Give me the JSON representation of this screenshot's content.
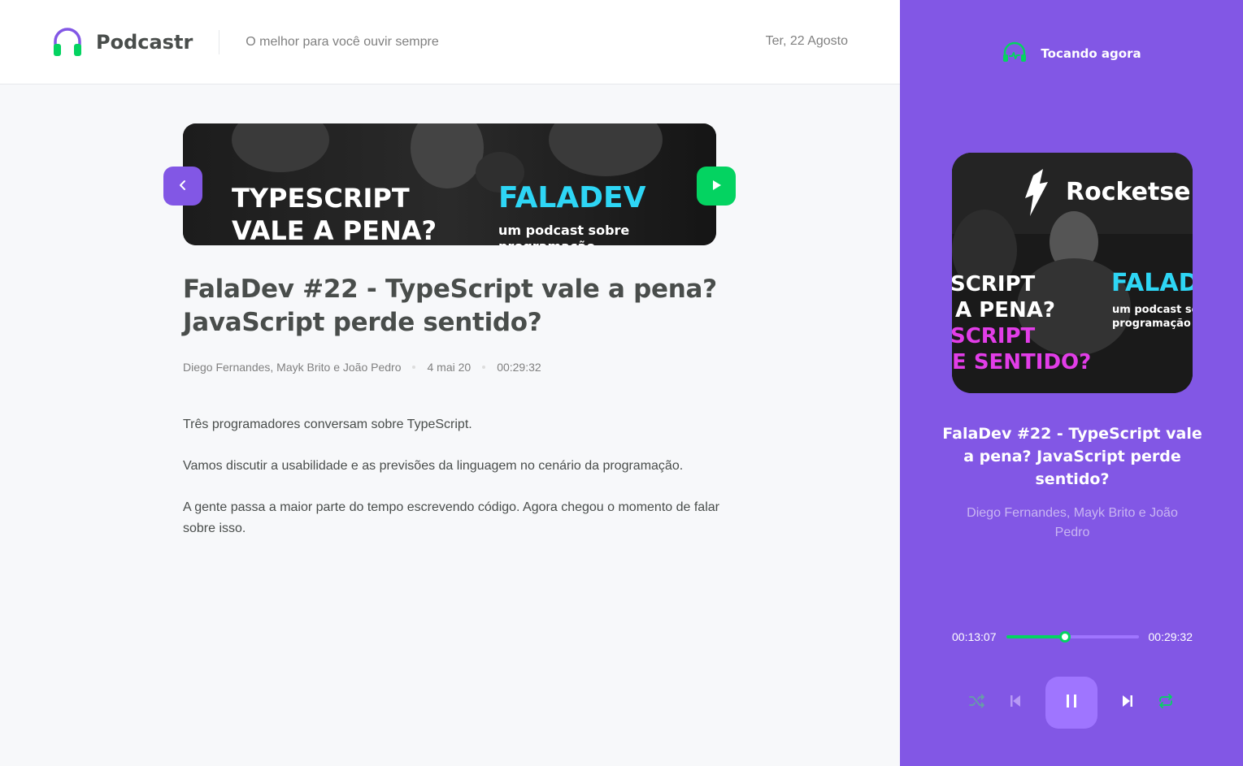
{
  "header": {
    "logo_text": "Podcastr",
    "tagline": "O melhor para você ouvir sempre",
    "date": "Ter, 22 Agosto"
  },
  "episode": {
    "title": "FalaDev #22 - TypeScript vale a pena? JavaScript perde sentido?",
    "members": "Diego Fernandes, Mayk Brito e João Pedro",
    "published_at": "4 mai 20",
    "duration": "00:29:32",
    "thumbnail_text": {
      "left_line1": "TYPESCRIPT",
      "left_line2": "VALE A PENA?",
      "brand": "FALADEV",
      "brand_sub1": "um podcast sobre",
      "brand_sub2": "programação"
    },
    "description": [
      "Três programadores conversam sobre TypeScript.",
      "Vamos discutir a usabilidade e as previsões da linguagem no cenário da programação.",
      "A gente passa a maior parte do tempo escrevendo código. Agora chegou o momento de falar sobre isso."
    ]
  },
  "player": {
    "header_label": "Tocando agora",
    "cover_text": {
      "brand": "Rocketse",
      "line1": "SCRIPT",
      "line2": "A PENA?",
      "line3": "SCRIPT",
      "line4": "E SENTIDO?",
      "faladev": "FALAD",
      "sub1": "um podcast sob",
      "sub2": "programação"
    },
    "title": "FalaDev #22 - TypeScript vale a pena? JavaScript perde sentido?",
    "members": "Diego Fernandes, Mayk Brito e João Pedro",
    "current_time": "00:13:07",
    "total_time": "00:29:32",
    "progress_fraction": 0.444
  },
  "colors": {
    "purple": "#8257E5",
    "purple_light": "#9F75FF",
    "green": "#04D361",
    "text_dark": "#494D4B",
    "text_gray": "#808080"
  },
  "icons": [
    "headphones-icon",
    "chevron-left-icon",
    "play-icon",
    "playing-icon",
    "shuffle-icon",
    "previous-icon",
    "pause-icon",
    "next-icon",
    "repeat-icon"
  ]
}
